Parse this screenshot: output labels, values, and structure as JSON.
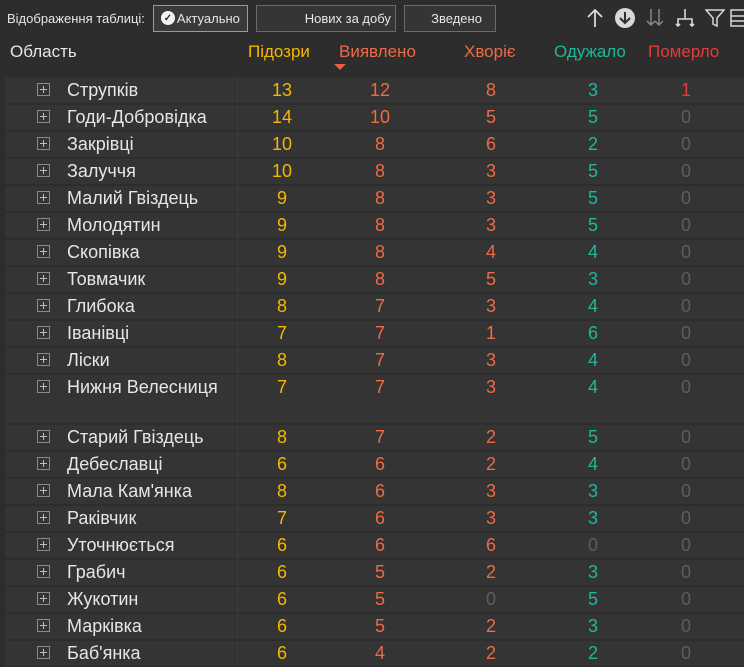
{
  "toolbar": {
    "label": "Відображення таблиці:",
    "btn_actual": "Актуально",
    "btn_new": "Нових за добу",
    "btn_summary": "Зведено"
  },
  "icons": [
    "arrow-up-icon",
    "arrow-down-circle-icon",
    "sort-icon",
    "tree-collapse-icon",
    "filter-icon",
    "export-icon"
  ],
  "colors": {
    "suspected": "#f5b800",
    "detected": "#ef6a45",
    "sick": "#ef6a45",
    "recovered": "#1fb89a",
    "deaths": "#e53b3b",
    "zero": "#5d5d5d"
  },
  "header": {
    "region": "Область",
    "suspected": "Підозри",
    "detected": "Виявлено",
    "sick": "Хворіє",
    "recovered": "Одужало",
    "deaths": "Померло"
  },
  "rows": [
    {
      "name": "Струпків",
      "suspected": "13",
      "detected": "12",
      "sick": "8",
      "recovered": "3",
      "deaths": "1"
    },
    {
      "name": "Годи-Добровідка",
      "suspected": "14",
      "detected": "10",
      "sick": "5",
      "recovered": "5",
      "deaths": "0"
    },
    {
      "name": "Закрівці",
      "suspected": "10",
      "detected": "8",
      "sick": "6",
      "recovered": "2",
      "deaths": "0"
    },
    {
      "name": "Залуччя",
      "suspected": "10",
      "detected": "8",
      "sick": "3",
      "recovered": "5",
      "deaths": "0"
    },
    {
      "name": "Малий Гвіздець",
      "suspected": "9",
      "detected": "8",
      "sick": "3",
      "recovered": "5",
      "deaths": "0"
    },
    {
      "name": "Молодятин",
      "suspected": "9",
      "detected": "8",
      "sick": "3",
      "recovered": "5",
      "deaths": "0"
    },
    {
      "name": "Скопівка",
      "suspected": "9",
      "detected": "8",
      "sick": "4",
      "recovered": "4",
      "deaths": "0"
    },
    {
      "name": "Товмачик",
      "suspected": "9",
      "detected": "8",
      "sick": "5",
      "recovered": "3",
      "deaths": "0"
    },
    {
      "name": "Глибока",
      "suspected": "8",
      "detected": "7",
      "sick": "3",
      "recovered": "4",
      "deaths": "0"
    },
    {
      "name": "Іванівці",
      "suspected": "7",
      "detected": "7",
      "sick": "1",
      "recovered": "6",
      "deaths": "0"
    },
    {
      "name": "Ліски",
      "suspected": "8",
      "detected": "7",
      "sick": "3",
      "recovered": "4",
      "deaths": "0"
    },
    {
      "name": "Нижня Велесниця",
      "suspected": "7",
      "detected": "7",
      "sick": "3",
      "recovered": "4",
      "deaths": "0"
    },
    {
      "name": "Старий Гвіздець",
      "suspected": "8",
      "detected": "7",
      "sick": "2",
      "recovered": "5",
      "deaths": "0"
    },
    {
      "name": "Дебеславці",
      "suspected": "6",
      "detected": "6",
      "sick": "2",
      "recovered": "4",
      "deaths": "0"
    },
    {
      "name": "Мала Кам'янка",
      "suspected": "8",
      "detected": "6",
      "sick": "3",
      "recovered": "3",
      "deaths": "0"
    },
    {
      "name": "Раківчик",
      "suspected": "7",
      "detected": "6",
      "sick": "3",
      "recovered": "3",
      "deaths": "0"
    },
    {
      "name": "Уточнюється",
      "suspected": "6",
      "detected": "6",
      "sick": "6",
      "recovered": "0",
      "deaths": "0"
    },
    {
      "name": "Грабич",
      "suspected": "6",
      "detected": "5",
      "sick": "2",
      "recovered": "3",
      "deaths": "0"
    },
    {
      "name": "Жукотин",
      "suspected": "6",
      "detected": "5",
      "sick": "0",
      "recovered": "5",
      "deaths": "0"
    },
    {
      "name": "Марківка",
      "suspected": "6",
      "detected": "5",
      "sick": "2",
      "recovered": "3",
      "deaths": "0"
    },
    {
      "name": "Баб'янка",
      "suspected": "6",
      "detected": "4",
      "sick": "2",
      "recovered": "2",
      "deaths": "0"
    }
  ]
}
